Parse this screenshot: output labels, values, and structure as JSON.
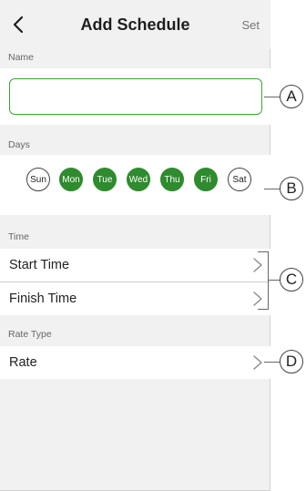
{
  "header": {
    "title": "Add Schedule",
    "set_label": "Set",
    "back_icon": "chevron-left-icon"
  },
  "name_section": {
    "label": "Name",
    "value": "",
    "placeholder": ""
  },
  "days_section": {
    "label": "Days",
    "days": [
      {
        "label": "Sun",
        "selected": false
      },
      {
        "label": "Mon",
        "selected": true
      },
      {
        "label": "Tue",
        "selected": true
      },
      {
        "label": "Wed",
        "selected": true
      },
      {
        "label": "Thu",
        "selected": true
      },
      {
        "label": "Fri",
        "selected": true
      },
      {
        "label": "Sat",
        "selected": false
      }
    ]
  },
  "time_section": {
    "label": "Time",
    "start_label": "Start Time",
    "finish_label": "Finish Time"
  },
  "rate_section": {
    "label": "Rate Type",
    "rate_label": "Rate"
  },
  "callouts": {
    "a": "A",
    "b": "B",
    "c": "C",
    "d": "D"
  },
  "colors": {
    "accent": "#2e8b2e",
    "input_border": "#3aa43a",
    "background": "#f1f1f1"
  }
}
